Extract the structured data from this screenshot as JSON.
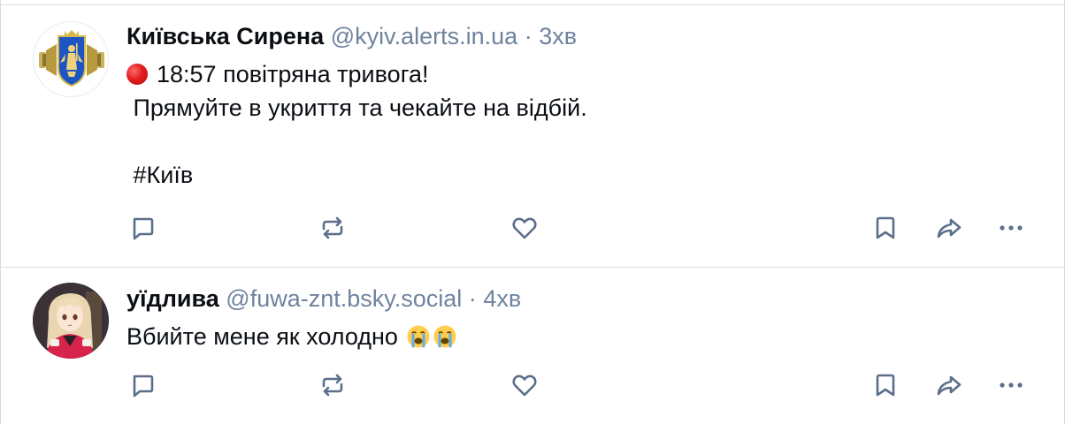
{
  "colors": {
    "text": "#0b0f14",
    "muted": "#6f839f",
    "border": "#d4dbe2",
    "icon": "#5b6f8a"
  },
  "posts": [
    {
      "author_name": "Київська Сирена",
      "handle": "@kyiv.alerts.in.ua",
      "separator": "·",
      "time": "3хв",
      "lines": [
        "18:57 повітряна тривога!",
        " Прямуйте в укриття та чекайте на відбій.",
        "",
        " #Київ"
      ],
      "avatar_icon": "kyiv-coat-of-arms-siren-icon",
      "alert_icon": "red-circle-icon"
    },
    {
      "author_name": "уїдлива",
      "handle": "@fuwa-znt.bsky.social",
      "separator": "·",
      "time": "4хв",
      "lines": [
        "Вбийте мене як холодно"
      ],
      "avatar_icon": "anime-girl-avatar-icon",
      "emoji_icon": "loudly-crying-face-icon"
    }
  ],
  "actions": [
    "reply-icon",
    "repost-icon",
    "like-icon",
    "bookmark-icon",
    "share-icon",
    "more-icon"
  ]
}
